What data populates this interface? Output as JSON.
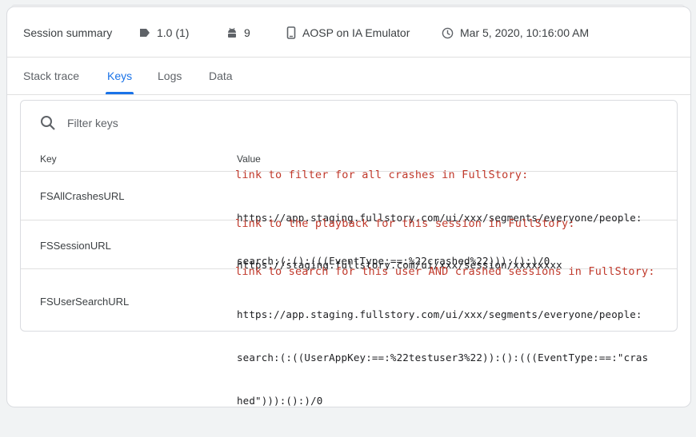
{
  "summary": {
    "title": "Session summary",
    "version": "1.0 (1)",
    "os_version": "9",
    "device": "AOSP on IA Emulator",
    "timestamp": "Mar 5, 2020, 10:16:00 AM"
  },
  "tabs": [
    {
      "label": "Stack trace",
      "active": false
    },
    {
      "label": "Keys",
      "active": true
    },
    {
      "label": "Logs",
      "active": false
    },
    {
      "label": "Data",
      "active": false
    }
  ],
  "filter": {
    "placeholder": "Filter keys"
  },
  "table": {
    "columns": [
      "Key",
      "Value"
    ],
    "rows": [
      {
        "key": "FSAllCrashesURL",
        "annotation": "link to filter for all crashes in FullStory:",
        "value_lines": [
          "https://app.staging.fullstory.com/ui/xxx/segments/everyone/people:",
          "search:(:():(((EventType:==:%22crashed%22))):():)/0"
        ]
      },
      {
        "key": "FSSessionURL",
        "annotation": "link to the playback for this session in FullStory:",
        "value_lines": [
          "https://staging.fullstory.com/ui/xxx/session/xxxxxxxx"
        ]
      },
      {
        "key": "FSUserSearchURL",
        "annotation": "link to search for this user AND crashed sessions in FullStory:",
        "value_lines": [
          "https://app.staging.fullstory.com/ui/xxx/segments/everyone/people:",
          "search:(:((UserAppKey:==:%22testuser3%22)):():(((EventType:==:\"cras",
          "hed\"))):():)/0"
        ]
      }
    ]
  },
  "colors": {
    "accent": "#1a73e8",
    "annotation": "#c0392b"
  },
  "icons": [
    "tag-icon",
    "android-icon",
    "phone-icon",
    "clock-icon",
    "search-icon"
  ]
}
